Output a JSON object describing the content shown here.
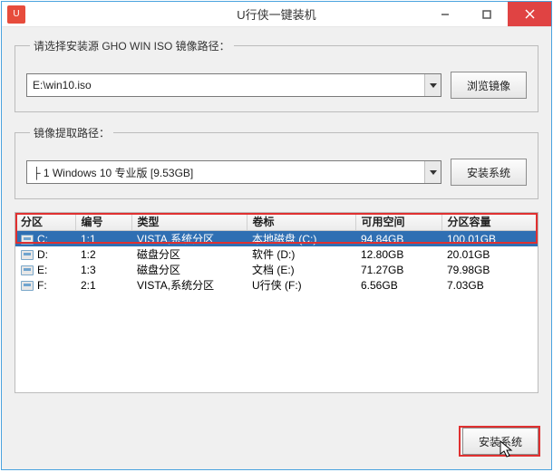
{
  "titlebar": {
    "app_icon_label": "U",
    "title": "U行侠一键装机"
  },
  "source": {
    "legend": "请选择安装源 GHO WIN ISO 镜像路径：",
    "combo_value": "E:\\win10.iso",
    "browse_label": "浏览镜像"
  },
  "extract": {
    "legend": "镜像提取路径：",
    "combo_value": "├ 1 Windows 10 专业版 [9.53GB]",
    "install_label": "安装系统"
  },
  "columns": {
    "partition": "分区",
    "index": "编号",
    "type": "类型",
    "label": "卷标",
    "free": "可用空间",
    "capacity": "分区容量"
  },
  "rows": [
    {
      "partition": "C:",
      "index": "1:1",
      "type": "VISTA,系统分区",
      "label": "本地磁盘 (C:)",
      "free": "94.84GB",
      "capacity": "100.01GB",
      "selected": true
    },
    {
      "partition": "D:",
      "index": "1:2",
      "type": "磁盘分区",
      "label": "软件 (D:)",
      "free": "12.80GB",
      "capacity": "20.01GB",
      "selected": false
    },
    {
      "partition": "E:",
      "index": "1:3",
      "type": "磁盘分区",
      "label": "文档 (E:)",
      "free": "71.27GB",
      "capacity": "79.98GB",
      "selected": false
    },
    {
      "partition": "F:",
      "index": "2:1",
      "type": "VISTA,系统分区",
      "label": "U行侠 (F:)",
      "free": "6.56GB",
      "capacity": "7.03GB",
      "selected": false
    }
  ],
  "footer": {
    "install_label": "安装系统"
  }
}
